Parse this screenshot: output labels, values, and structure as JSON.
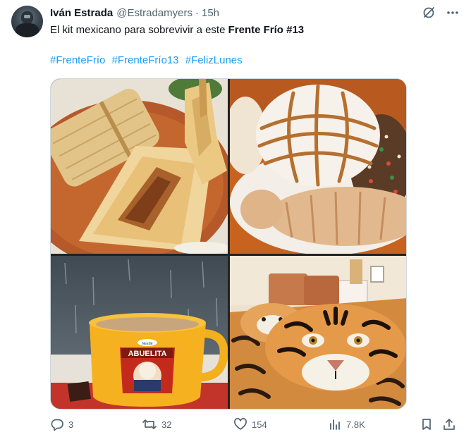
{
  "author": {
    "display_name": "Iván Estrada",
    "handle": "@Estradamyers",
    "separator": "·",
    "time": "15h"
  },
  "tweet": {
    "text_plain": "El kit mexicano para sobrevivir a este ",
    "text_bold": "Frente Frío #13",
    "hashtags": [
      "#FrenteFrío",
      "#FrenteFrío13",
      "#FelizLunes"
    ]
  },
  "media": {
    "images": [
      {
        "name": "tamales-image",
        "subject": "tamales"
      },
      {
        "name": "conchas-image",
        "subject": "pan dulce"
      },
      {
        "name": "abuelita-mug-image",
        "subject": "hot chocolate mug",
        "label": "ABUELITA",
        "brand_badge": "Nestlé"
      },
      {
        "name": "tiger-blanket-image",
        "subject": "tiger blanket bed"
      }
    ]
  },
  "actions": {
    "replies": "3",
    "reposts": "32",
    "likes": "154",
    "views": "7.8K"
  },
  "icons": [
    "grok-icon",
    "more-icon",
    "reply-icon",
    "repost-icon",
    "like-icon",
    "views-icon",
    "bookmark-icon",
    "share-icon"
  ],
  "colors": {
    "text": "#0f1419",
    "secondary": "#536471",
    "link": "#1d9bf0",
    "border": "#cfd9de"
  }
}
